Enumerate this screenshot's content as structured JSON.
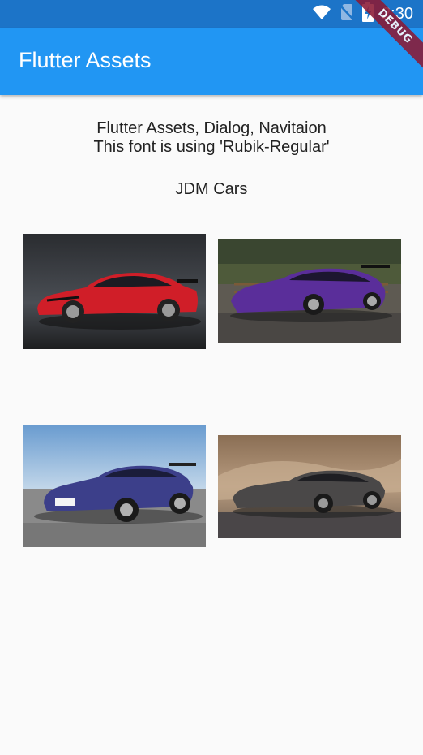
{
  "status_bar": {
    "time": "2:30",
    "icons": [
      "wifi-icon",
      "no-sim-icon",
      "battery-charging-icon"
    ]
  },
  "app_bar": {
    "title": "Flutter Assets"
  },
  "debug_banner": {
    "label": "DEBUG"
  },
  "main": {
    "heading_line_1": "Flutter Assets, Dialog, Navitaion",
    "heading_line_2": "This font is using 'Rubik-Regular'",
    "section_title": "JDM Cars",
    "cars": [
      {
        "description": "red car on dark studio background",
        "color": "#d01e28"
      },
      {
        "description": "purple car parked outdoors by trees",
        "color": "#5a2e9a"
      },
      {
        "description": "dark blue car on pavement under sky",
        "color": "#3c3f8a"
      },
      {
        "description": "grey car on desert road",
        "color": "#4a4848"
      }
    ]
  }
}
